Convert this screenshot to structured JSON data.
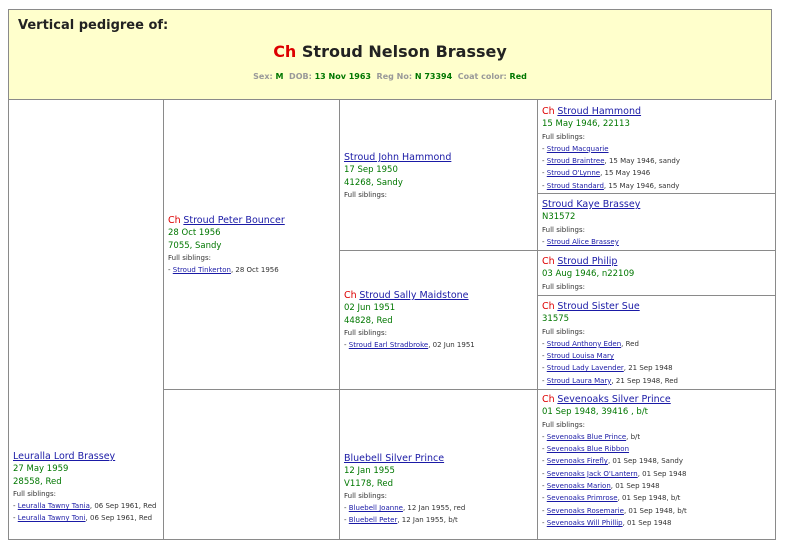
{
  "header": {
    "title": "Vertical pedigree of:",
    "ch": "Ch",
    "dog_name": "Stroud Nelson Brassey",
    "sex_label": "Sex:",
    "sex": "M",
    "dob_label": "DOB:",
    "dob": "13 Nov 1963",
    "reg_label": "Reg No:",
    "reg": "N 73394",
    "coat_label": "Coat color:",
    "coat": "Red"
  },
  "labels": {
    "full_siblings": "Full siblings:",
    "ch": "Ch"
  },
  "gen1": {
    "sire": {
      "name": "Leuralla Lord Brassey",
      "date": "27 May 1959",
      "reg": "28558, Red",
      "siblings": [
        {
          "name": "Leuralla Tawny Tania",
          "info": ", 06 Sep 1961, Red"
        },
        {
          "name": "Leuralla Tawny Toni",
          "info": ", 06 Sep 1961, Red"
        }
      ]
    }
  },
  "gen2": {
    "sire": {
      "name": "Stroud Peter Bouncer",
      "date": "28 Oct 1956",
      "reg": "7055, Sandy",
      "siblings": [
        {
          "name": "Stroud Tinkerton",
          "info": ", 28 Oct 1956"
        }
      ]
    }
  },
  "gen3": {
    "ss": {
      "name": "Stroud John Hammond",
      "date": "17 Sep 1950",
      "reg": "41268, Sandy"
    },
    "sd": {
      "name": "Stroud Sally Maidstone",
      "date": "02 Jun 1951",
      "reg": "44828, Red",
      "siblings": [
        {
          "name": "Stroud Earl Stradbroke",
          "info": ", 02 Jun 1951"
        }
      ]
    },
    "ds": {
      "name": "Bluebell Silver Prince",
      "date": "12 Jan 1955",
      "reg": "V1178, Red",
      "siblings": [
        {
          "name": "Bluebell Joanne",
          "info": ", 12 Jan 1955, red"
        },
        {
          "name": "Bluebell Peter",
          "info": ", 12 Jan 1955, b/t"
        }
      ]
    }
  },
  "gen4": {
    "sss": {
      "name": "Stroud Hammond",
      "line": "15 May 1946, 22113",
      "siblings": [
        {
          "name": "Stroud Macquarie",
          "info": ""
        },
        {
          "name": "Stroud Braintree",
          "info": ", 15 May 1946, sandy"
        },
        {
          "name": "Stroud O'Lynne",
          "info": ", 15 May 1946"
        },
        {
          "name": "Stroud Standard",
          "info": ", 15 May 1946, sandy"
        }
      ]
    },
    "ssd": {
      "name": "Stroud Kaye Brassey",
      "line": "N31572",
      "siblings": [
        {
          "name": "Stroud Alice Brassey",
          "info": ""
        }
      ]
    },
    "sds": {
      "name": "Stroud Philip",
      "line": "03 Aug 1946, n22109"
    },
    "sdd": {
      "name": "Stroud Sister Sue",
      "line": "31575",
      "siblings": [
        {
          "name": "Stroud Anthony Eden",
          "info": ", Red"
        },
        {
          "name": "Stroud Louisa Mary",
          "info": ""
        },
        {
          "name": "Stroud Lady Lavender",
          "info": ", 21 Sep 1948"
        },
        {
          "name": "Stroud Laura Mary",
          "info": ", 21 Sep 1948, Red"
        }
      ]
    },
    "dss": {
      "name": "Sevenoaks Silver Prince",
      "line": "01 Sep 1948, 39416 , b/t",
      "siblings": [
        {
          "name": "Sevenoaks Blue Prince",
          "info": ", b/t"
        },
        {
          "name": "Sevenoaks Blue Ribbon",
          "info": ""
        },
        {
          "name": "Sevenoaks Firefly",
          "info": ", 01 Sep 1948, Sandy"
        },
        {
          "name": "Sevenoaks Jack O'Lantern",
          "info": ", 01 Sep 1948"
        },
        {
          "name": "Sevenoaks Marion",
          "info": ", 01 Sep 1948"
        },
        {
          "name": "Sevenoaks Primrose",
          "info": ", 01 Sep 1948, b/t"
        },
        {
          "name": "Sevenoaks Rosemarie",
          "info": ", 01 Sep 1948, b/t"
        },
        {
          "name": "Sevenoaks Will Phillip",
          "info": ", 01 Sep 1948"
        }
      ]
    }
  }
}
